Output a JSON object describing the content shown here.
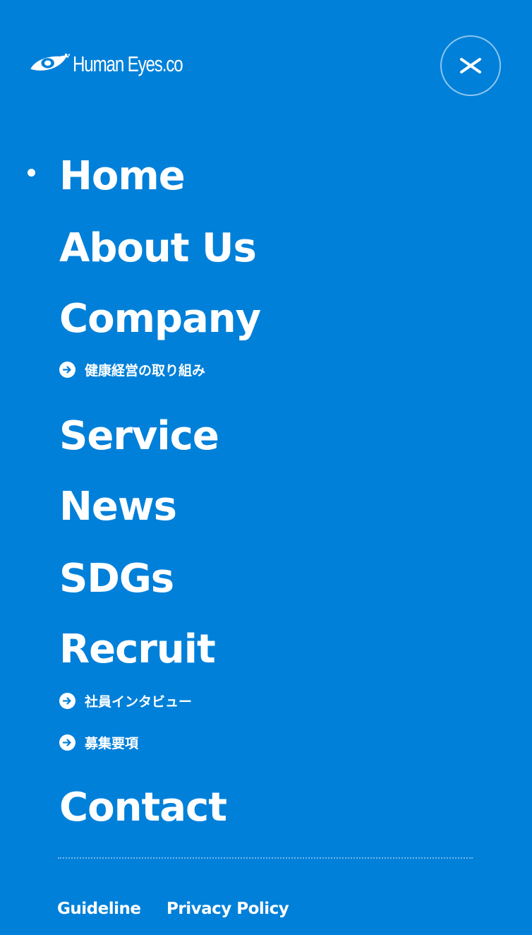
{
  "brand": {
    "logo_text": "Human Eyes.co"
  },
  "header": {
    "close_icon": "close-icon"
  },
  "nav": {
    "items": [
      {
        "label": "Home",
        "active": true
      },
      {
        "label": "About Us"
      },
      {
        "label": "Company",
        "subitems": [
          {
            "label": "健康経営の取り組み",
            "icon": "arrow-right-circle-icon"
          }
        ]
      },
      {
        "label": "Service"
      },
      {
        "label": "News"
      },
      {
        "label": "SDGs"
      },
      {
        "label": "Recruit",
        "subitems": [
          {
            "label": "社員インタビュー",
            "icon": "arrow-right-circle-icon"
          },
          {
            "label": "募集要項",
            "icon": "arrow-right-circle-icon"
          }
        ]
      },
      {
        "label": "Contact"
      }
    ]
  },
  "footer": {
    "links": [
      {
        "label": "Guideline"
      },
      {
        "label": "Privacy Policy"
      }
    ]
  },
  "colors": {
    "background": "#0080d9",
    "text": "#ffffff"
  }
}
